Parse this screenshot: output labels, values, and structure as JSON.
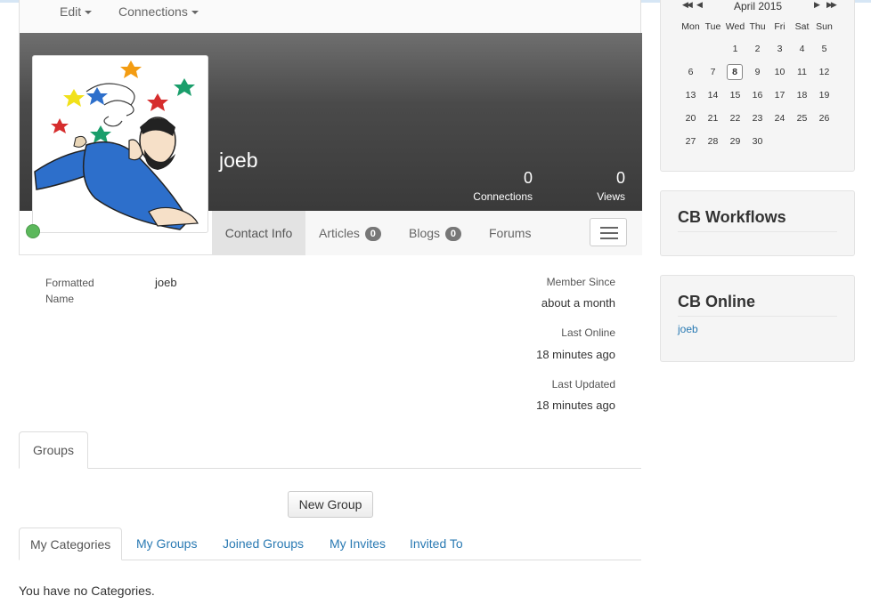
{
  "menu": {
    "edit_label": "Edit",
    "connections_label": "Connections"
  },
  "profile": {
    "username": "joeb",
    "connections_count": "0",
    "connections_label": "Connections",
    "views_count": "0",
    "views_label": "Views",
    "online_status_color": "#5cb85c"
  },
  "tabs": [
    {
      "label": "Contact Info",
      "active": true
    },
    {
      "label": "Articles",
      "badge": "0"
    },
    {
      "label": "Blogs",
      "badge": "0"
    },
    {
      "label": "Forums"
    }
  ],
  "contact": {
    "formatted_name_label_1": "Formatted",
    "formatted_name_label_2": "Name",
    "formatted_name_value": "joeb",
    "member_since_label": "Member Since",
    "member_since_value": "about a month",
    "last_online_label": "Last Online",
    "last_online_value": "18 minutes ago",
    "last_updated_label": "Last Updated",
    "last_updated_value": "18 minutes ago"
  },
  "groups": {
    "tab_label": "Groups",
    "new_group_label": "New Group",
    "subtabs": [
      "My Categories",
      "My Groups",
      "Joined Groups",
      "My Invites",
      "Invited To"
    ],
    "empty_message": "You have no Categories."
  },
  "calendar": {
    "month_label": "April 2015",
    "nav_prev_year": "◀◀",
    "nav_prev": "◀",
    "nav_next": "▶",
    "nav_next_year": "▶▶",
    "weekdays": [
      "Mon",
      "Tue",
      "Wed",
      "Thu",
      "Fri",
      "Sat",
      "Sun"
    ],
    "weeks": [
      [
        "",
        "",
        "1",
        "2",
        "3",
        "4",
        "5"
      ],
      [
        "6",
        "7",
        "8",
        "9",
        "10",
        "11",
        "12"
      ],
      [
        "13",
        "14",
        "15",
        "16",
        "17",
        "18",
        "19"
      ],
      [
        "20",
        "21",
        "22",
        "23",
        "24",
        "25",
        "26"
      ],
      [
        "27",
        "28",
        "29",
        "30",
        "",
        "",
        ""
      ]
    ],
    "today": "8"
  },
  "sidebar": {
    "workflows_title": "CB Workflows",
    "online_title": "CB Online",
    "online_users": [
      "joeb"
    ]
  },
  "colors": {
    "link": "#2a7ab3",
    "badge": "#777777",
    "online": "#5cb85c"
  }
}
